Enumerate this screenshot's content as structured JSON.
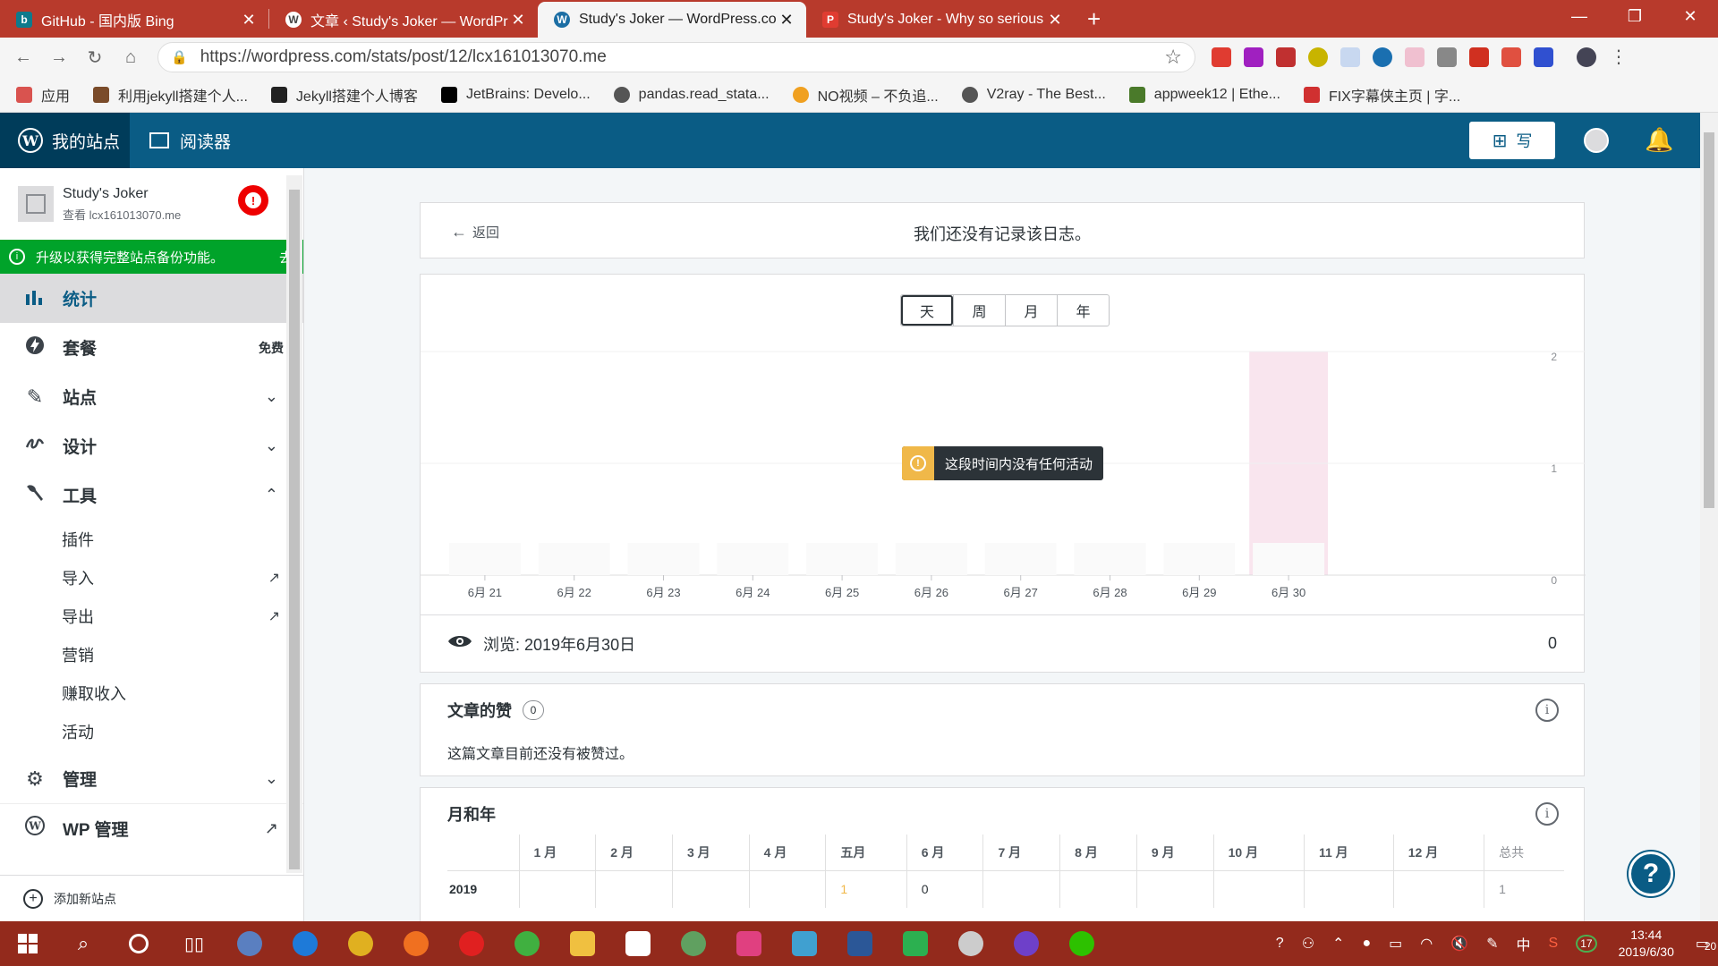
{
  "browser": {
    "tabs": [
      {
        "title": "GitHub - 国内版 Bing",
        "favicon": "bing-icon",
        "color": "#0e7a8c",
        "glyph": "b",
        "active": false
      },
      {
        "title": "文章 ‹ Study's Joker — WordPr",
        "favicon": "wordpress-icon",
        "color": "#ffffff",
        "glyph": "W",
        "active": false
      },
      {
        "title": "Study's Joker — WordPress.co",
        "favicon": "wordpress-icon",
        "color": "#1c6ea4",
        "glyph": "W",
        "active": true
      },
      {
        "title": "Study's Joker - Why so serious",
        "favicon": "p-icon",
        "color": "#e03c31",
        "glyph": "P",
        "active": false
      }
    ],
    "url": "https://wordpress.com/stats/post/12/lcx161013070.me",
    "bookmarks": [
      {
        "label": "应用",
        "icon": "apps-grid-icon",
        "color": "#d9534f"
      },
      {
        "label": "利用jekyll搭建个人...",
        "icon": "jekyll-icon",
        "color": "#7a4b2a"
      },
      {
        "label": "Jekyll搭建个人博客",
        "icon": "w-icon",
        "color": "#222222"
      },
      {
        "label": "JetBrains: Develo...",
        "icon": "jetbrains-icon",
        "color": "#000000"
      },
      {
        "label": "pandas.read_stata...",
        "icon": "globe-icon",
        "color": "#555555"
      },
      {
        "label": "NO视频 – 不负追...",
        "icon": "play-icon",
        "color": "#f0a020"
      },
      {
        "label": "V2ray - The Best...",
        "icon": "globe-icon",
        "color": "#555555"
      },
      {
        "label": "appweek12 | Ethe...",
        "icon": "appweek-icon",
        "color": "#4a7a2a"
      },
      {
        "label": "FIX字幕侠主页 | 字...",
        "icon": "fix-icon",
        "color": "#d03030"
      }
    ]
  },
  "masterbar": {
    "my_sites": "我的站点",
    "reader": "阅读器",
    "write": "写"
  },
  "sidebar": {
    "site_name": "Study's Joker",
    "site_url": "查看 lcx161013070.me",
    "upgrade_text": "升级以获得完整站点备份功能。",
    "upgrade_go": "去",
    "items": [
      {
        "label": "统计",
        "icon": "stats-bars-icon",
        "glyph": "▮",
        "selected": true
      },
      {
        "label": "套餐",
        "icon": "jetpack-bolt-icon",
        "glyph": "ϟ",
        "badge": "免费"
      },
      {
        "label": "站点",
        "icon": "pencil-icon",
        "glyph": "✎",
        "chevron": "down"
      },
      {
        "label": "设计",
        "icon": "brush-icon",
        "glyph": "ഴ",
        "chevron": "down"
      },
      {
        "label": "工具",
        "icon": "wrench-icon",
        "glyph": "🔧",
        "chevron": "up"
      }
    ],
    "tools_sub": [
      {
        "label": "插件",
        "external": false
      },
      {
        "label": "导入",
        "external": true
      },
      {
        "label": "导出",
        "external": true
      },
      {
        "label": "营销",
        "external": false
      },
      {
        "label": "赚取收入",
        "external": false
      },
      {
        "label": "活动",
        "external": false
      }
    ],
    "bottom_items": [
      {
        "label": "管理",
        "icon": "gear-icon",
        "glyph": "⚙",
        "chevron": "down"
      },
      {
        "label": "WP 管理",
        "icon": "wordpress-icon",
        "glyph": "W",
        "external": true
      }
    ],
    "add_site": "添加新站点"
  },
  "header": {
    "back": "返回",
    "title": "我们还没有记录该日志。"
  },
  "period_tabs": [
    "天",
    "周",
    "月",
    "年"
  ],
  "chart_data": {
    "type": "bar",
    "categories": [
      "6月 21",
      "6月 22",
      "6月 23",
      "6月 24",
      "6月 25",
      "6月 26",
      "6月 27",
      "6月 28",
      "6月 29",
      "6月 30"
    ],
    "values": [
      0,
      0,
      0,
      0,
      0,
      0,
      0,
      0,
      0,
      0
    ],
    "y_ticks": [
      "2",
      "1",
      "0"
    ],
    "ylim": [
      0,
      2
    ],
    "highlight_index": 9,
    "highlight_color": "#f9e5ee",
    "grid": true
  },
  "tooltip": "这段时间内没有任何活动",
  "views": {
    "label": "浏览: 2019年6月30日",
    "value": "0"
  },
  "likes": {
    "title": "文章的赞",
    "count": "0",
    "text": "这篇文章目前还没有被赞过。"
  },
  "months": {
    "title": "月和年",
    "headers": [
      "",
      "1 月",
      "2 月",
      "3 月",
      "4 月",
      "五月",
      "6 月",
      "7 月",
      "8 月",
      "9 月",
      "10 月",
      "11 月",
      "12 月",
      "总共"
    ],
    "rows": [
      [
        "2019",
        "",
        "",
        "",
        "",
        "1",
        "0",
        "",
        "",
        "",
        "",
        "",
        "",
        "1"
      ]
    ]
  },
  "taskbar": {
    "time": "13:44",
    "date": "2019/6/30",
    "notifications": "20",
    "tray_badge": "17",
    "ime": "中"
  }
}
